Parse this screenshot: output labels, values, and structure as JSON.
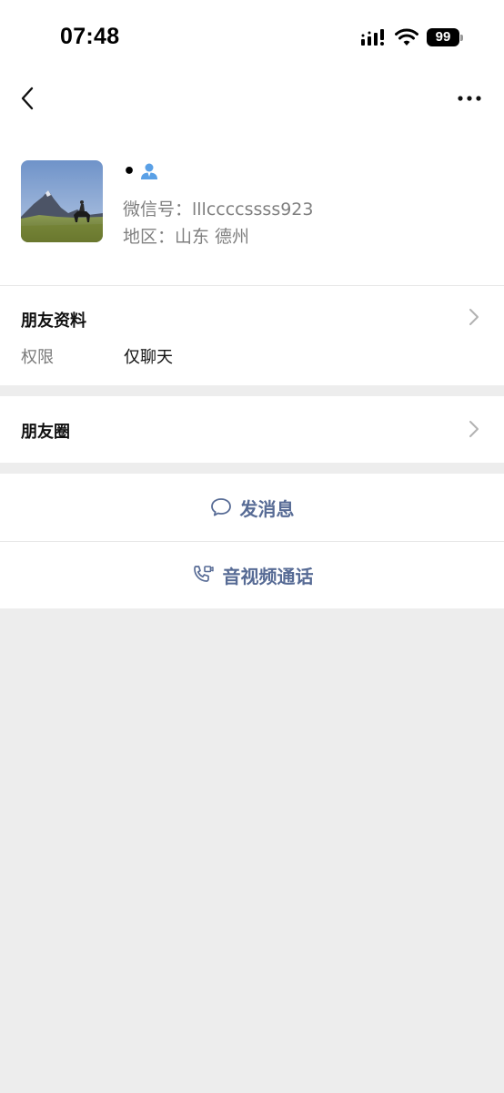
{
  "status_bar": {
    "time": "07:48",
    "battery": "99"
  },
  "nav": {
    "back_icon": "chevron-left-icon",
    "more_icon": "ellipsis-icon"
  },
  "profile": {
    "name": "•",
    "wechat_id": "微信号：lllccccssss923",
    "region": "地区：山东 德州",
    "avatar_icon": "mountain-horse-rider-photo",
    "contact_icon": "contact-person-icon"
  },
  "info": {
    "title": "朋友资料",
    "permission_label": "权限",
    "permission_value": "仅聊天"
  },
  "moments": {
    "title": "朋友圈"
  },
  "actions": {
    "message_label": "发消息",
    "call_label": "音视频通话"
  },
  "colors": {
    "link": "#576b95",
    "contact_icon": "#5aa0e6",
    "background": "#ededed"
  }
}
